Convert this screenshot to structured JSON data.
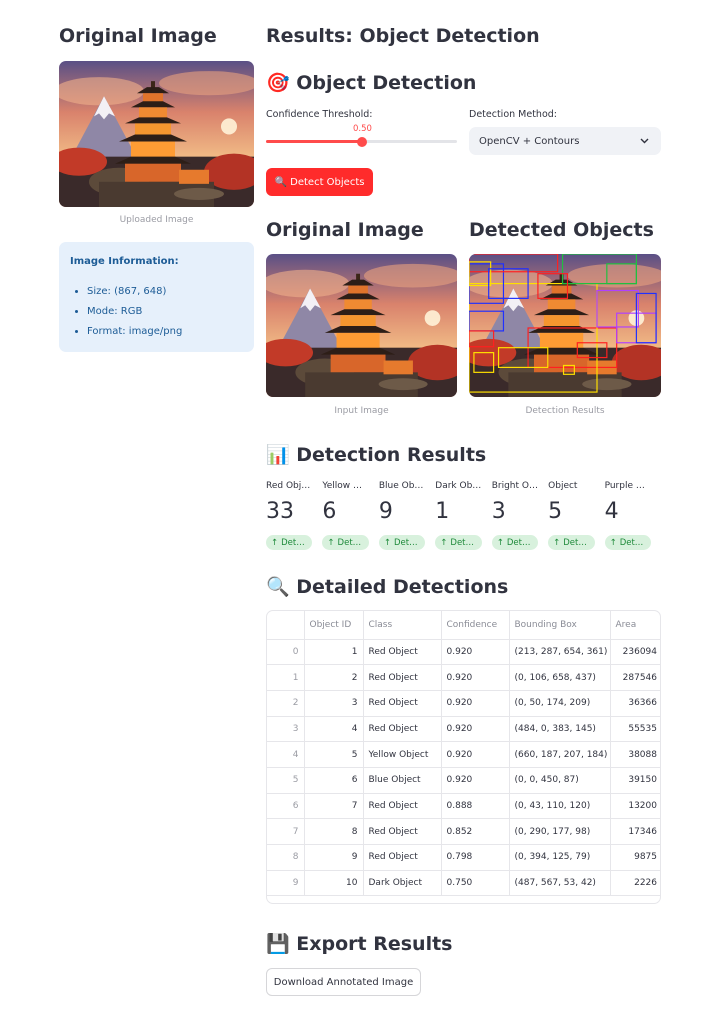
{
  "left": {
    "title": "Original Image",
    "image_caption": "Uploaded Image",
    "info_title": "Image Information:",
    "info_items": [
      "Size: (867, 648)",
      "Mode: RGB",
      "Format: image/png"
    ]
  },
  "main": {
    "title": "Results: Object Detection",
    "detection_header": "🎯 Object Detection",
    "confidence_label": "Confidence Threshold:",
    "confidence_value": "0.50",
    "confidence_fraction": 0.5,
    "method_label": "Detection Method:",
    "method_value": "OpenCV + Contours",
    "detect_button": "🔍 Detect Objects",
    "original_title": "Original Image",
    "detected_title": "Detected Objects",
    "input_caption": "Input Image",
    "results_caption": "Detection Results",
    "results_header": "📊 Detection Results",
    "metrics": [
      {
        "label": "Red Objects",
        "value": "33",
        "delta": "Detected"
      },
      {
        "label": "Yellow Objects",
        "value": "6",
        "delta": "Detected"
      },
      {
        "label": "Blue Objects",
        "value": "9",
        "delta": "Detected"
      },
      {
        "label": "Dark Objects",
        "value": "1",
        "delta": "Detected"
      },
      {
        "label": "Bright Objects",
        "value": "3",
        "delta": "Detected"
      },
      {
        "label": "Object",
        "value": "5",
        "delta": "Detected"
      },
      {
        "label": "Purple Objects",
        "value": "4",
        "delta": "Detected"
      }
    ],
    "detailed_header": "🔍 Detailed Detections",
    "table": {
      "columns": [
        "",
        "Object ID",
        "Class",
        "Confidence",
        "Bounding Box",
        "Area"
      ],
      "rows": [
        [
          "0",
          "1",
          "Red Object",
          "0.920",
          "(213, 287, 654, 361)",
          "236094"
        ],
        [
          "1",
          "2",
          "Red Object",
          "0.920",
          "(0, 106, 658, 437)",
          "287546"
        ],
        [
          "2",
          "3",
          "Red Object",
          "0.920",
          "(0, 50, 174, 209)",
          "36366"
        ],
        [
          "3",
          "4",
          "Red Object",
          "0.920",
          "(484, 0, 383, 145)",
          "55535"
        ],
        [
          "4",
          "5",
          "Yellow Object",
          "0.920",
          "(660, 187, 207, 184)",
          "38088"
        ],
        [
          "5",
          "6",
          "Blue Object",
          "0.920",
          "(0, 0, 450, 87)",
          "39150"
        ],
        [
          "6",
          "7",
          "Red Object",
          "0.888",
          "(0, 43, 110, 120)",
          "13200"
        ],
        [
          "7",
          "8",
          "Red Object",
          "0.852",
          "(0, 290, 177, 98)",
          "17346"
        ],
        [
          "8",
          "9",
          "Red Object",
          "0.798",
          "(0, 394, 125, 79)",
          "9875"
        ],
        [
          "9",
          "10",
          "Dark Object",
          "0.750",
          "(487, 567, 53, 42)",
          "2226"
        ]
      ]
    },
    "export_header": "💾 Export Results",
    "download_button": "Download Annotated Image"
  },
  "colors": {
    "accent": "#ff4b4b",
    "primary_button": "#ff2b2b",
    "info_bg": "#e6f0fb",
    "info_text": "#1d5c96",
    "delta_bg": "#d8f1dd",
    "delta_text": "#1e8a3a"
  }
}
